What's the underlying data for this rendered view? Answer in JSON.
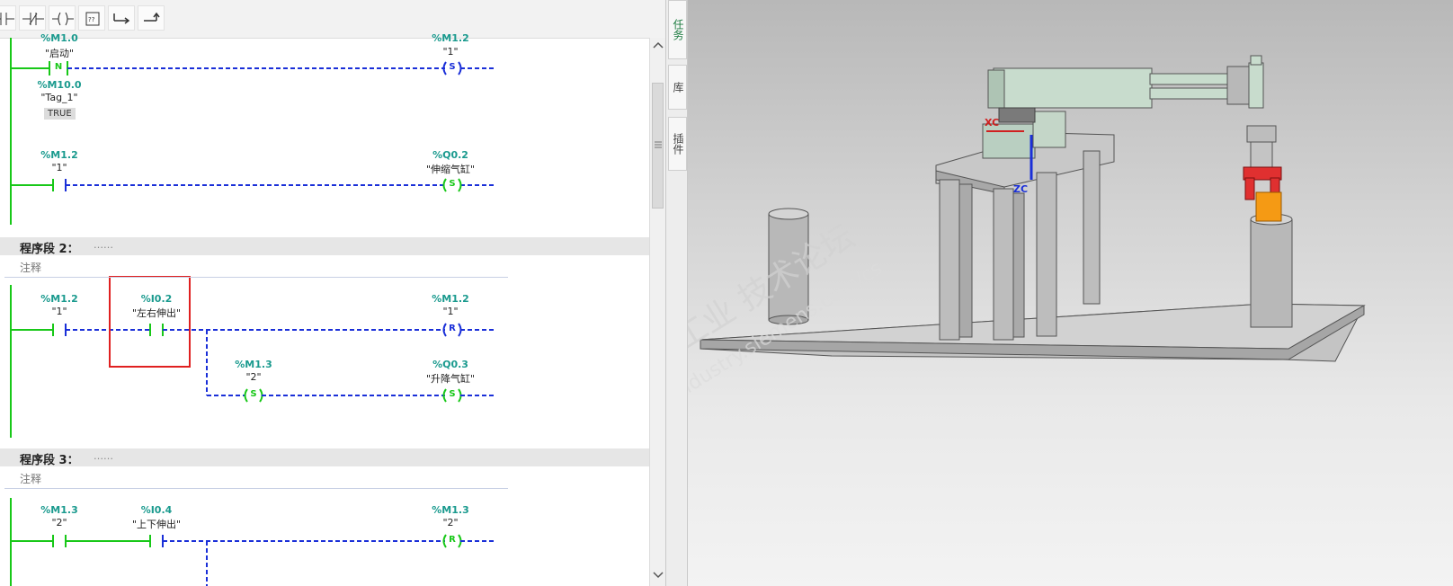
{
  "toolbar": {
    "buttons": [
      {
        "name": "contact-no-icon"
      },
      {
        "name": "contact-nc-icon"
      },
      {
        "name": "coil-icon"
      },
      {
        "name": "empty-box-icon",
        "glyph": "??"
      },
      {
        "name": "open-branch-icon"
      },
      {
        "name": "close-branch-icon"
      }
    ]
  },
  "networks": {
    "n1": {
      "row1": {
        "contact_addr": "%M1.0",
        "contact_tag": "\"启动\"",
        "contact_type": "N",
        "coil_addr": "%M1.2",
        "coil_tag": "\"1\"",
        "coil_type": "S"
      },
      "monitor": {
        "addr": "%M10.0",
        "tag": "\"Tag_1\"",
        "value": "TRUE"
      },
      "row2": {
        "contact_addr": "%M1.2",
        "contact_tag": "\"1\"",
        "coil_addr": "%Q0.2",
        "coil_tag": "\"伸缩气缸\"",
        "coil_type": "S"
      }
    },
    "n2": {
      "header": "程序段 2：",
      "header_dots": "……",
      "comment": "注释",
      "row1": {
        "c1_addr": "%M1.2",
        "c1_tag": "\"1\"",
        "c2_addr": "%I0.2",
        "c2_tag": "\"左右伸出\"",
        "coil_addr": "%M1.2",
        "coil_tag": "\"1\"",
        "coil_type": "R"
      },
      "row2": {
        "coil1_addr": "%M1.3",
        "coil1_tag": "\"2\"",
        "coil1_type": "S",
        "coil2_addr": "%Q0.3",
        "coil2_tag": "\"升降气缸\"",
        "coil2_type": "S"
      }
    },
    "n3": {
      "header": "程序段 3：",
      "header_dots": "……",
      "comment": "注释",
      "row1": {
        "c1_addr": "%M1.3",
        "c1_tag": "\"2\"",
        "c2_addr": "%I0.4",
        "c2_tag": "\"上下伸出\"",
        "coil_addr": "%M1.3",
        "coil_tag": "\"2\"",
        "coil_type": "R"
      }
    }
  },
  "sidebar": {
    "tabs": [
      "任务",
      "库",
      "插件"
    ]
  },
  "viewport": {
    "axis_labels": {
      "xc": "XC",
      "zc": "ZC"
    },
    "watermark": "西门子工业 技术论坛",
    "watermark_url": "support.industry.siemens.com/cs"
  },
  "colors": {
    "energized": "#18c818",
    "unpowered": "#1a2fd8",
    "address": "#1a9a8e",
    "highlight": "#e02020"
  }
}
